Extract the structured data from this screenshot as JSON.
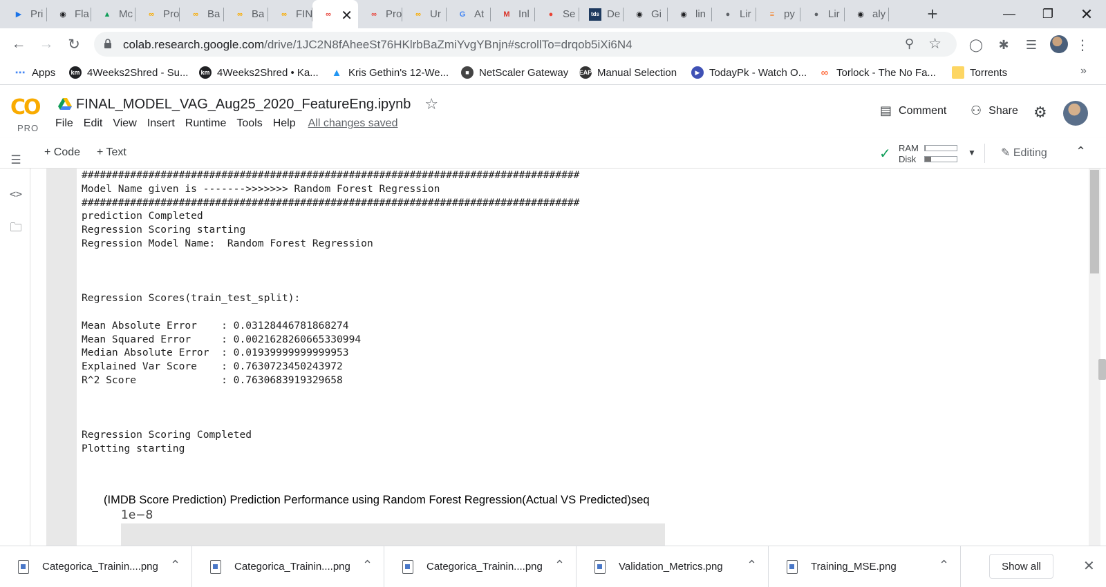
{
  "browser": {
    "tabs": [
      {
        "label": "Pri",
        "icon": "play-circle-icon",
        "color": "#1a73e8"
      },
      {
        "label": "Fla",
        "icon": "github-icon",
        "color": "#202124"
      },
      {
        "label": "Mc",
        "icon": "google-drive-icon",
        "color": "#0f9d58"
      },
      {
        "label": "Pro",
        "icon": "colab-icon",
        "color": "#f9ab00"
      },
      {
        "label": "Ba",
        "icon": "colab-icon",
        "color": "#f9ab00"
      },
      {
        "label": "Ba",
        "icon": "colab-icon",
        "color": "#f9ab00"
      },
      {
        "label": "FIN",
        "icon": "colab-icon",
        "color": "#f9ab00"
      },
      {
        "label": "",
        "icon": "colab-icon",
        "color": "#e8453c",
        "active": true
      },
      {
        "label": "Pro",
        "icon": "colab-icon",
        "color": "#e8453c"
      },
      {
        "label": "Ur",
        "icon": "colab-icon",
        "color": "#f9ab00"
      },
      {
        "label": "At",
        "icon": "google-icon",
        "color": "#4285f4"
      },
      {
        "label": "Inl",
        "icon": "gmail-icon",
        "color": "#d93025"
      },
      {
        "label": "Se",
        "icon": "record-icon",
        "color": "#ea4335"
      },
      {
        "label": "De",
        "icon": "tds-icon",
        "color": "#1e3a5f"
      },
      {
        "label": "Gi",
        "icon": "github-icon",
        "color": "#202124"
      },
      {
        "label": "lin",
        "icon": "github-icon",
        "color": "#202124"
      },
      {
        "label": "Lir",
        "icon": "globe-icon",
        "color": "#5f6368"
      },
      {
        "label": "py",
        "icon": "stackoverflow-icon",
        "color": "#f48024"
      },
      {
        "label": "Lir",
        "icon": "globe-icon",
        "color": "#5f6368"
      },
      {
        "label": "aly",
        "icon": "github-icon",
        "color": "#202124"
      }
    ],
    "url_host": "colab.research.google.com",
    "url_path": "/drive/1JC2N8fAheeSt76HKlrbBaZmiYvgYBnjn#scrollTo=drqob5iXi6N4",
    "bookmarks": [
      {
        "label": "Apps",
        "icon": "apps-grid-icon",
        "color": "#4285f4"
      },
      {
        "label": "4Weeks2Shred - Su...",
        "icon": "km-icon",
        "color": "#202124"
      },
      {
        "label": "4Weeks2Shred • Ka...",
        "icon": "km-icon",
        "color": "#202124"
      },
      {
        "label": "Kris Gethin's 12-We...",
        "icon": "bodybuilding-icon",
        "color": "#2196f3"
      },
      {
        "label": "NetScaler Gateway",
        "icon": "netscaler-icon",
        "color": "#444444"
      },
      {
        "label": "Manual Selection",
        "icon": "eap-icon",
        "color": "#333333"
      },
      {
        "label": "TodayPk - Watch O...",
        "icon": "play-icon",
        "color": "#3f51b5"
      },
      {
        "label": "Torlock - The No Fa...",
        "icon": "torlock-icon",
        "color": "#ff7043"
      },
      {
        "label": "Torrents",
        "icon": "folder-icon",
        "color": "#fdd663"
      }
    ]
  },
  "colab": {
    "logo_text": "CO",
    "plan": "PRO",
    "notebook_title": "FINAL_MODEL_VAG_Aug25_2020_FeatureEng.ipynb",
    "menu": [
      "File",
      "Edit",
      "View",
      "Insert",
      "Runtime",
      "Tools",
      "Help"
    ],
    "save_status": "All changes saved",
    "comment_label": "Comment",
    "share_label": "Share",
    "add_code_label": "+ Code",
    "add_text_label": "+ Text",
    "ram_label": "RAM",
    "disk_label": "Disk",
    "ram_fraction": 0.03,
    "disk_fraction": 0.2,
    "editing_label": "Editing",
    "accent_color": "#f9ab00"
  },
  "output": {
    "lines": [
      "##################################################################################",
      "Model Name given is ------->>>>>>> Random Forest Regression",
      "##################################################################################",
      "prediction Completed",
      "Regression Scoring starting",
      "Regression Model Name:  Random Forest Regression",
      "",
      "",
      "",
      "Regression Scores(train_test_split):",
      "",
      "Mean Absolute Error    : 0.03128446781868274",
      "Mean Squared Error     : 0.0021628260665330994",
      "Median Absolute Error  : 0.01939999999999953",
      "Explained Var Score    : 0.7630723450243972",
      "R^2 Score              : 0.7630683919329658",
      "",
      "",
      "",
      "Regression Scoring Completed",
      "Plotting starting"
    ],
    "plot_title": "(IMDB Score Prediction) Prediction Performance using Random Forest Regression(Actual VS Predicted)seq",
    "plot_axis_exponent": "1e−8"
  },
  "downloads": {
    "items": [
      "Categorica_Trainin....png",
      "Categorica_Trainin....png",
      "Categorica_Trainin....png",
      "Validation_Metrics.png",
      "Training_MSE.png"
    ],
    "show_all_label": "Show all"
  }
}
